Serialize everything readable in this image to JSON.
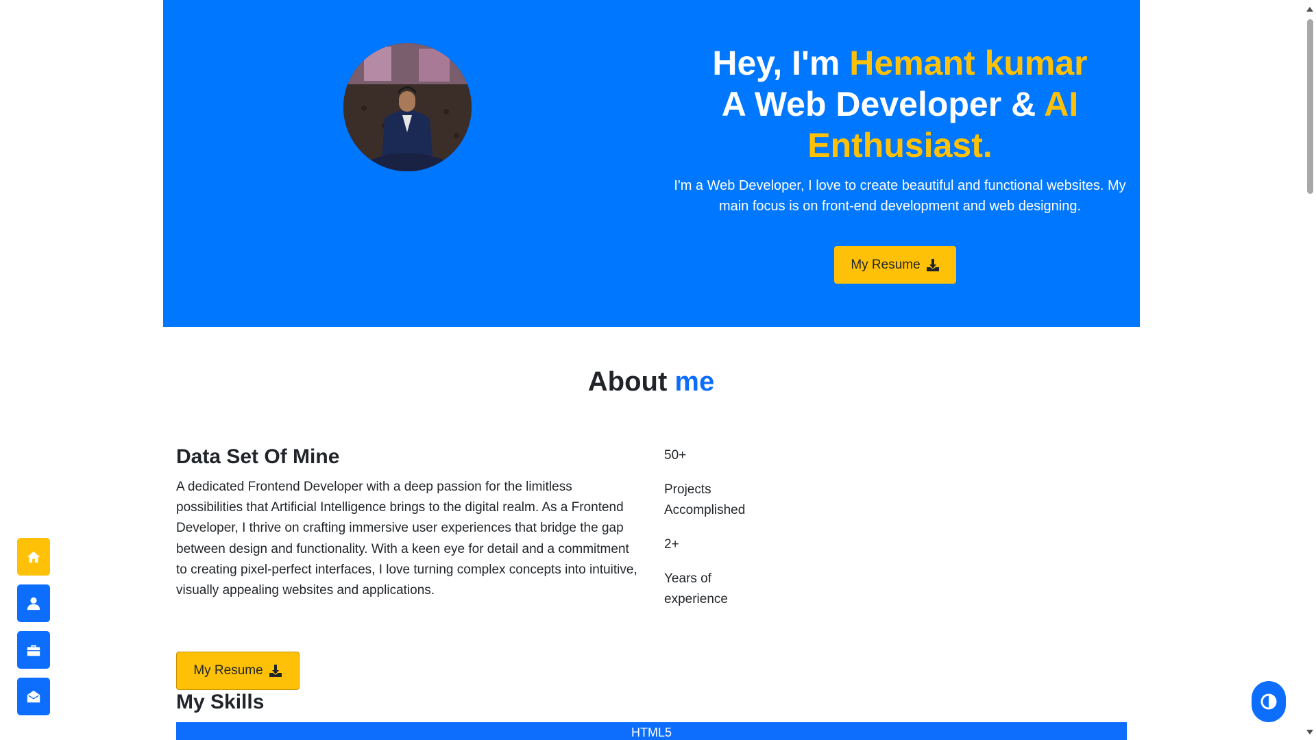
{
  "hero": {
    "title_prefix": "Hey, I'm ",
    "name": "Hemant kumar",
    "line2_prefix": "A Web Developer & ",
    "line2_highlight": "AI Enthusiast.",
    "description": "I'm a Web Developer, I love to create beautiful and functional websites. My main focus is on front-end development and web designing.",
    "resume_label": "My Resume",
    "bg_color": "#0077ff",
    "accent_color": "#ffc107"
  },
  "about": {
    "heading_prefix": "About ",
    "heading_highlight": "me",
    "section_title": "Data Set Of Mine",
    "paragraph": "A dedicated Frontend Developer with a deep passion for the limitless possibilities that Artificial Intelligence brings to the digital realm. As a Frontend Developer, I thrive on crafting immersive user experiences that bridge the gap between design and functionality. With a keen eye for detail and a commitment to creating pixel-perfect interfaces, I love turning complex concepts into intuitive, visually appealing websites and applications.",
    "stats": [
      {
        "value": "50+",
        "label": "Projects Accomplished"
      },
      {
        "value": "2+",
        "label": "Years of experience"
      }
    ],
    "resume_label": "My Resume"
  },
  "skills": {
    "title": "My Skills",
    "items": [
      {
        "name": "HTML5",
        "level": 1.0
      }
    ]
  },
  "side_nav": {
    "items": [
      {
        "icon": "home-icon",
        "active": true
      },
      {
        "icon": "user-icon",
        "active": false
      },
      {
        "icon": "briefcase-icon",
        "active": false
      },
      {
        "icon": "envelope-open-icon",
        "active": false
      }
    ]
  },
  "theme_toggle": {
    "icon": "contrast-icon"
  }
}
